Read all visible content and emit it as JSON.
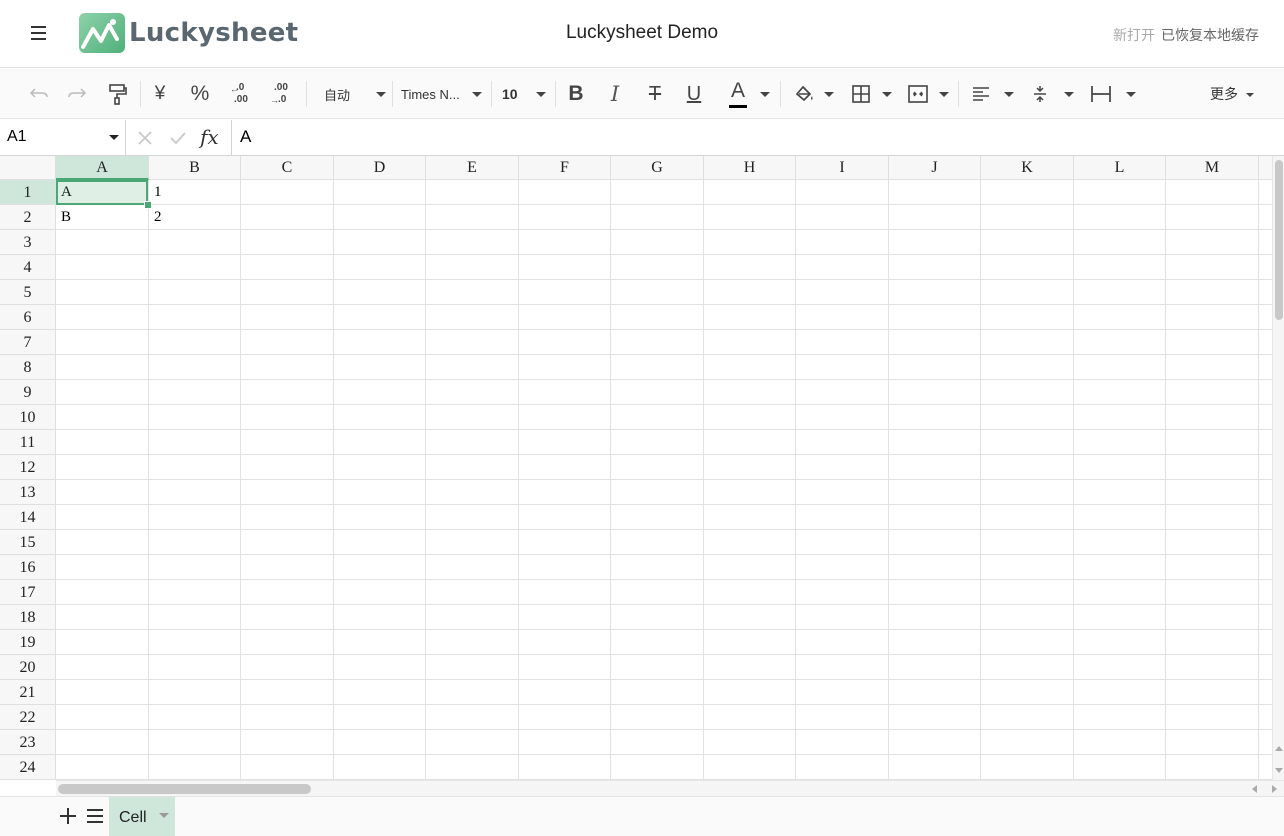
{
  "header": {
    "logo_text": "Luckysheet",
    "title": "Luckysheet Demo",
    "status_muted": "新打开",
    "status": "已恢复本地缓存"
  },
  "toolbar": {
    "currency_symbol": "¥",
    "percent_symbol": "%",
    "decimal_decrease": ".0",
    "decimal_decrease_sub": ".00",
    "decimal_increase": ".00",
    "decimal_increase_sub": ".0",
    "format": "自动",
    "font": "Times N...",
    "font_size": "10",
    "bold": "B",
    "italic": "I",
    "strike": "T",
    "underline": "U",
    "text_color_glyph": "A",
    "text_color": "#000000",
    "more": "更多"
  },
  "formula_bar": {
    "cell_ref": "A1",
    "fx": "fx",
    "value": "A"
  },
  "grid": {
    "columns": [
      "A",
      "B",
      "C",
      "D",
      "E",
      "F",
      "G",
      "H",
      "I",
      "J",
      "K",
      "L",
      "M"
    ],
    "rows": [
      "1",
      "2",
      "3",
      "4",
      "5",
      "6",
      "7",
      "8",
      "9",
      "10",
      "11",
      "12",
      "13",
      "14",
      "15",
      "16",
      "17",
      "18",
      "19",
      "20",
      "21",
      "22",
      "23",
      "24"
    ],
    "cells": [
      {
        "ref": "A1",
        "col": 0,
        "row": 0,
        "value": "A"
      },
      {
        "ref": "B1",
        "col": 1,
        "row": 0,
        "value": "1"
      },
      {
        "ref": "A2",
        "col": 0,
        "row": 1,
        "value": "B"
      },
      {
        "ref": "B2",
        "col": 1,
        "row": 1,
        "value": "2"
      }
    ],
    "selected": "A1",
    "accent": "#4ba874"
  },
  "sheets": [
    {
      "name": "Cell",
      "active": true
    }
  ]
}
